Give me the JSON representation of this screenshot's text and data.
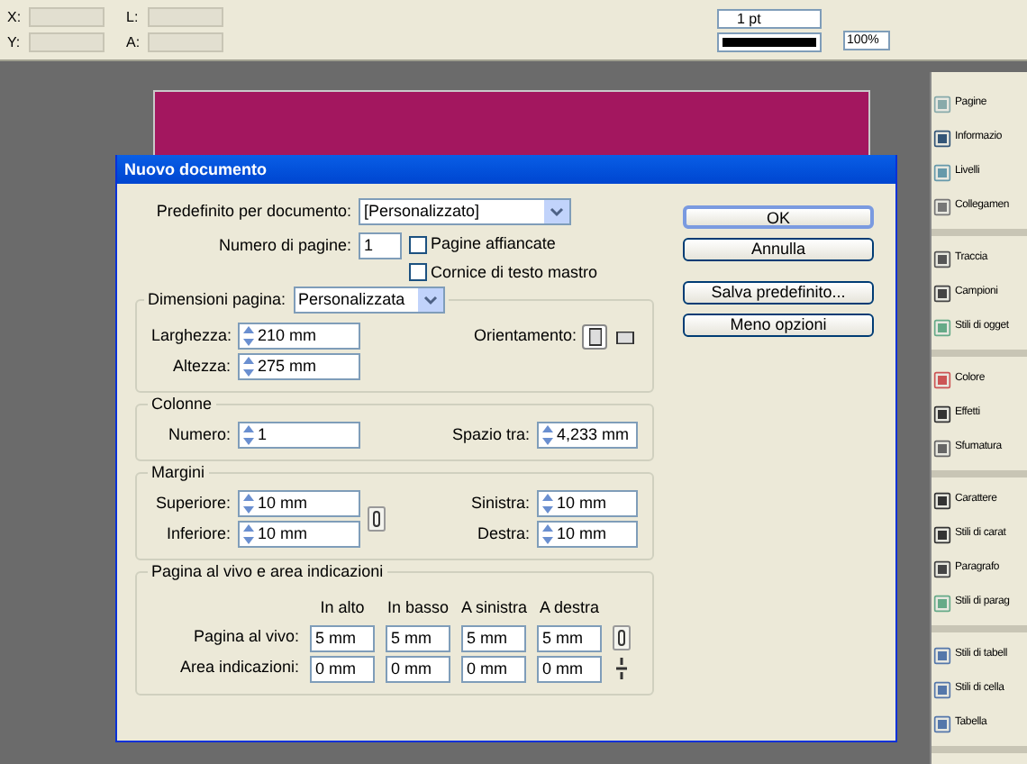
{
  "control_bar": {
    "x_label": "X:",
    "y_label": "Y:",
    "w_label": "L:",
    "h_label": "A:",
    "stroke_weight": "1 pt",
    "opacity": "100%"
  },
  "dialog": {
    "title": "Nuovo documento",
    "preset": {
      "label": "Predefinito per documento:",
      "value": "[Personalizzato]"
    },
    "pages": {
      "label": "Numero di pagine:",
      "value": "1"
    },
    "options": [
      {
        "label": "Pagine affiancate",
        "checked": false
      },
      {
        "label": "Cornice di testo mastro",
        "checked": false
      }
    ],
    "page_size": {
      "label": "Dimensioni pagina:",
      "value": "Personalizzata"
    },
    "width": {
      "label": "Larghezza:",
      "value": "210 mm"
    },
    "height": {
      "label": "Altezza:",
      "value": "275 mm"
    },
    "orientation": {
      "label": "Orientamento:",
      "options": [
        {
          "selected": true
        },
        {
          "selected": false
        }
      ]
    },
    "columns": {
      "title": "Colonne",
      "number": {
        "label": "Numero:",
        "value": "1"
      },
      "gutter": {
        "label": "Spazio tra:",
        "value": "4,233 mm"
      }
    },
    "margins": {
      "title": "Margini",
      "left_fields": [
        {
          "label": "Superiore:",
          "value": "10 mm"
        },
        {
          "label": "Inferiore:",
          "value": "10 mm"
        }
      ],
      "right_fields": [
        {
          "label": "Sinistra:",
          "value": "10 mm"
        },
        {
          "label": "Destra:",
          "value": "10 mm"
        }
      ]
    },
    "bleed": {
      "title": "Pagina al vivo e area indicazioni",
      "columns": [
        "In alto",
        "In basso",
        "A sinistra",
        "A destra"
      ],
      "rows": [
        {
          "label": "Pagina al vivo:",
          "values": [
            "5 mm",
            "5 mm",
            "5 mm",
            "5 mm"
          ],
          "linked": true
        },
        {
          "label": "Area indicazioni:",
          "values": [
            "0 mm",
            "0 mm",
            "0 mm",
            "0 mm"
          ],
          "linked": false
        }
      ]
    },
    "buttons": [
      {
        "label": "OK",
        "default": true
      },
      {
        "label": "Annulla",
        "default": false
      },
      {
        "label": "Salva predefinito...",
        "default": false
      },
      {
        "label": "Meno opzioni",
        "default": false
      }
    ]
  },
  "side_panel": {
    "groups": [
      [
        {
          "label": "Pagine"
        },
        {
          "label": "Informazio"
        },
        {
          "label": "Livelli"
        },
        {
          "label": "Collegamen"
        }
      ],
      [
        {
          "label": "Traccia"
        },
        {
          "label": "Campioni"
        },
        {
          "label": "Stili di ogget"
        }
      ],
      [
        {
          "label": "Colore"
        },
        {
          "label": "Effetti"
        },
        {
          "label": "Sfumatura"
        }
      ],
      [
        {
          "label": "Carattere"
        },
        {
          "label": "Stili di carat"
        },
        {
          "label": "Paragrafo"
        },
        {
          "label": "Stili di parag"
        }
      ],
      [
        {
          "label": "Stili di tabell"
        },
        {
          "label": "Stili di cella"
        },
        {
          "label": "Tabella"
        }
      ]
    ]
  }
}
